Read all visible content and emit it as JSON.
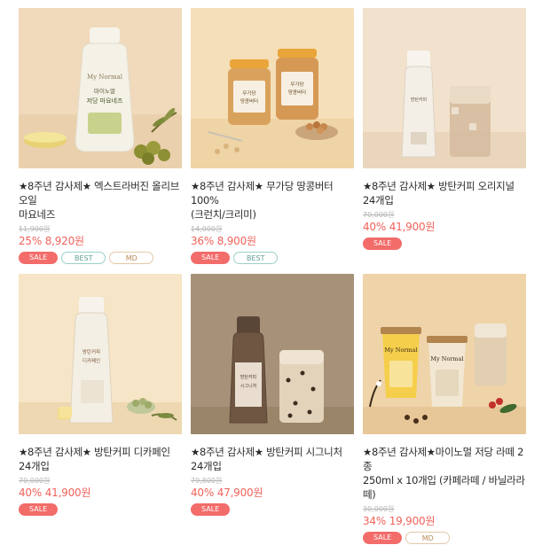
{
  "products": [
    {
      "name_line1": "★8주년 감사제★ 엑스트라버진 올리브오일",
      "name_line2": "마요네즈",
      "original_price": "11,900원",
      "discount": "25%",
      "price": "8,920원",
      "badges": [
        "SALE",
        "BEST",
        "MD"
      ],
      "bg": "#f2dcc0",
      "bottle_label": "My Normal",
      "bottle_text": "마이노멀 저당 마요네즈"
    },
    {
      "name_line1": "★8주년 감사제★ 무가당 땅콩버터 100%",
      "name_line2": "(크런치/크리미)",
      "original_price": "14,000원",
      "discount": "36%",
      "price": "8,900원",
      "badges": [
        "SALE",
        "BEST"
      ],
      "bg": "#f4deb6",
      "jar_text": "무가당 땅콩버터"
    },
    {
      "name_line1": "★8주년 감사제★ 방탄커피 오리지널",
      "name_line2": "24개입",
      "original_price": "70,000원",
      "discount": "40%",
      "price": "41,900원",
      "badges": [
        "SALE"
      ],
      "bg": "#f0e0cc"
    },
    {
      "name_line1": "★8주년 감사제★ 방탄커피 디카페인",
      "name_line2": "24개입",
      "original_price": "70,000원",
      "discount": "40%",
      "price": "41,900원",
      "badges": [
        "SALE"
      ],
      "bg": "#f5e4c6"
    },
    {
      "name_line1": "★8주년 감사제★ 방탄커피 시그니처",
      "name_line2": "24개입",
      "original_price": "79,800원",
      "discount": "40%",
      "price": "47,900원",
      "badges": [
        "SALE"
      ],
      "bg": "#a8957d"
    },
    {
      "name_line1": "★8주년 감사제★마이노멀 저당 라떼 2종",
      "name_line2": "250ml x 10개입 (카페라떼 / 바닐라라떼)",
      "original_price": "30,000원",
      "discount": "34%",
      "price": "19,900원",
      "badges": [
        "SALE",
        "MD"
      ],
      "bg": "#efd2a8",
      "cup_label": "My Normal"
    }
  ]
}
